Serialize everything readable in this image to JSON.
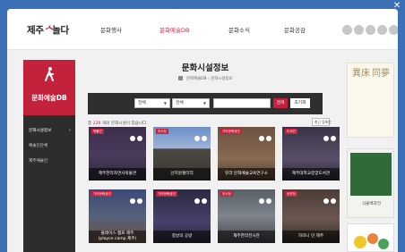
{
  "logo": {
    "part1": "제주",
    "part2": "ᄉ",
    "part3": "놀다"
  },
  "nav": [
    "문화행사",
    "문화예술DB",
    "문화소식",
    "문화공감"
  ],
  "nav_active_index": 1,
  "left_panel": {
    "title": "문화예술DB",
    "items": [
      "문화시설정보",
      "예술인단체",
      "제주예술인"
    ],
    "active_index": 0
  },
  "main": {
    "title": "문화시설정보",
    "breadcrumb": [
      "문화예술DB",
      "문화시설정보"
    ],
    "search": {
      "select1": "전체",
      "select2": "전체",
      "search_button": "검색",
      "reset_button": "초기화"
    },
    "count_prefix": "총",
    "count_value": "229",
    "count_suffix": "개의 문화시설이 있습니다.",
    "sort": "최근 등록순"
  },
  "cards": [
    {
      "badge": "박물관",
      "title": "제주한라자연사박물관"
    },
    {
      "badge": "전시장",
      "title": "선지원갤러리"
    },
    {
      "badge": "기타문화공간",
      "title": "뮤라 문화예술교육연구소"
    },
    {
      "badge": "도서관",
      "title": "제주대학교중앙도서관"
    },
    {
      "badge": "기타문화공간",
      "title": "플레이스 캠프 제주",
      "title2": "(playce camp 제주)"
    },
    {
      "badge": "기타문화공간",
      "title": "중날의 공방"
    },
    {
      "badge": "전시장",
      "title": "제주한라전시관"
    },
    {
      "badge": "공연장",
      "title": "하모니 인 제주"
    }
  ],
  "ads": {
    "top_left": "異床",
    "top_right": "同夢",
    "mid_caption": "식물백과전"
  },
  "colors": {
    "accent": "#c4213d",
    "frame": "#3b6fb6",
    "dark": "#2d2d2d"
  }
}
